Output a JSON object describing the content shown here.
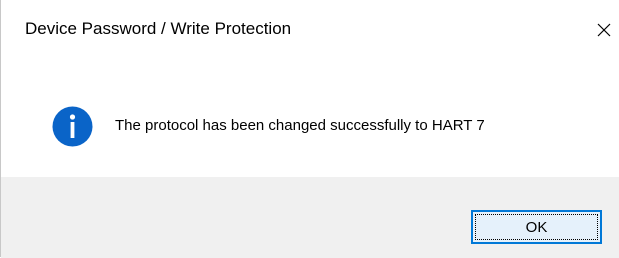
{
  "dialog": {
    "title": "Device Password / Write Protection",
    "message": "The protocol has been changed successfully to HART 7",
    "icon": "info-icon",
    "buttons": {
      "ok_label": "OK"
    },
    "close_icon": "close-icon"
  },
  "colors": {
    "info_icon_fill": "#0a64c8",
    "button_border": "#0078d7",
    "button_fill": "#e5f1fb",
    "footer_bg": "#f0f0f0"
  }
}
